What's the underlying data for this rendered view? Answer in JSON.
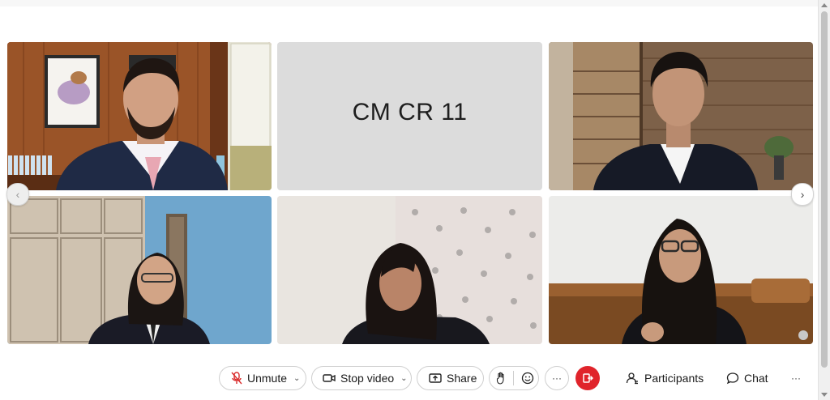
{
  "participants": {
    "placeholder_name": "CM CR 11"
  },
  "controls": {
    "unmute_label": "Unmute",
    "stop_video_label": "Stop video",
    "share_label": "Share",
    "more_label": "···",
    "participants_label": "Participants",
    "chat_label": "Chat",
    "menu_label": "···"
  },
  "icons": {
    "mic": "mic-muted-icon",
    "video": "video-camera-icon",
    "share": "share-screen-icon",
    "raise_hand": "raise-hand-icon",
    "reactions": "reactions-icon",
    "end": "leave-meeting-icon",
    "participants": "participants-icon",
    "chat": "chat-bubble-icon"
  },
  "colors": {
    "end_button": "#e0242b",
    "placeholder_tile": "#dcdcdc",
    "mic_muted": "#d92b2b"
  }
}
